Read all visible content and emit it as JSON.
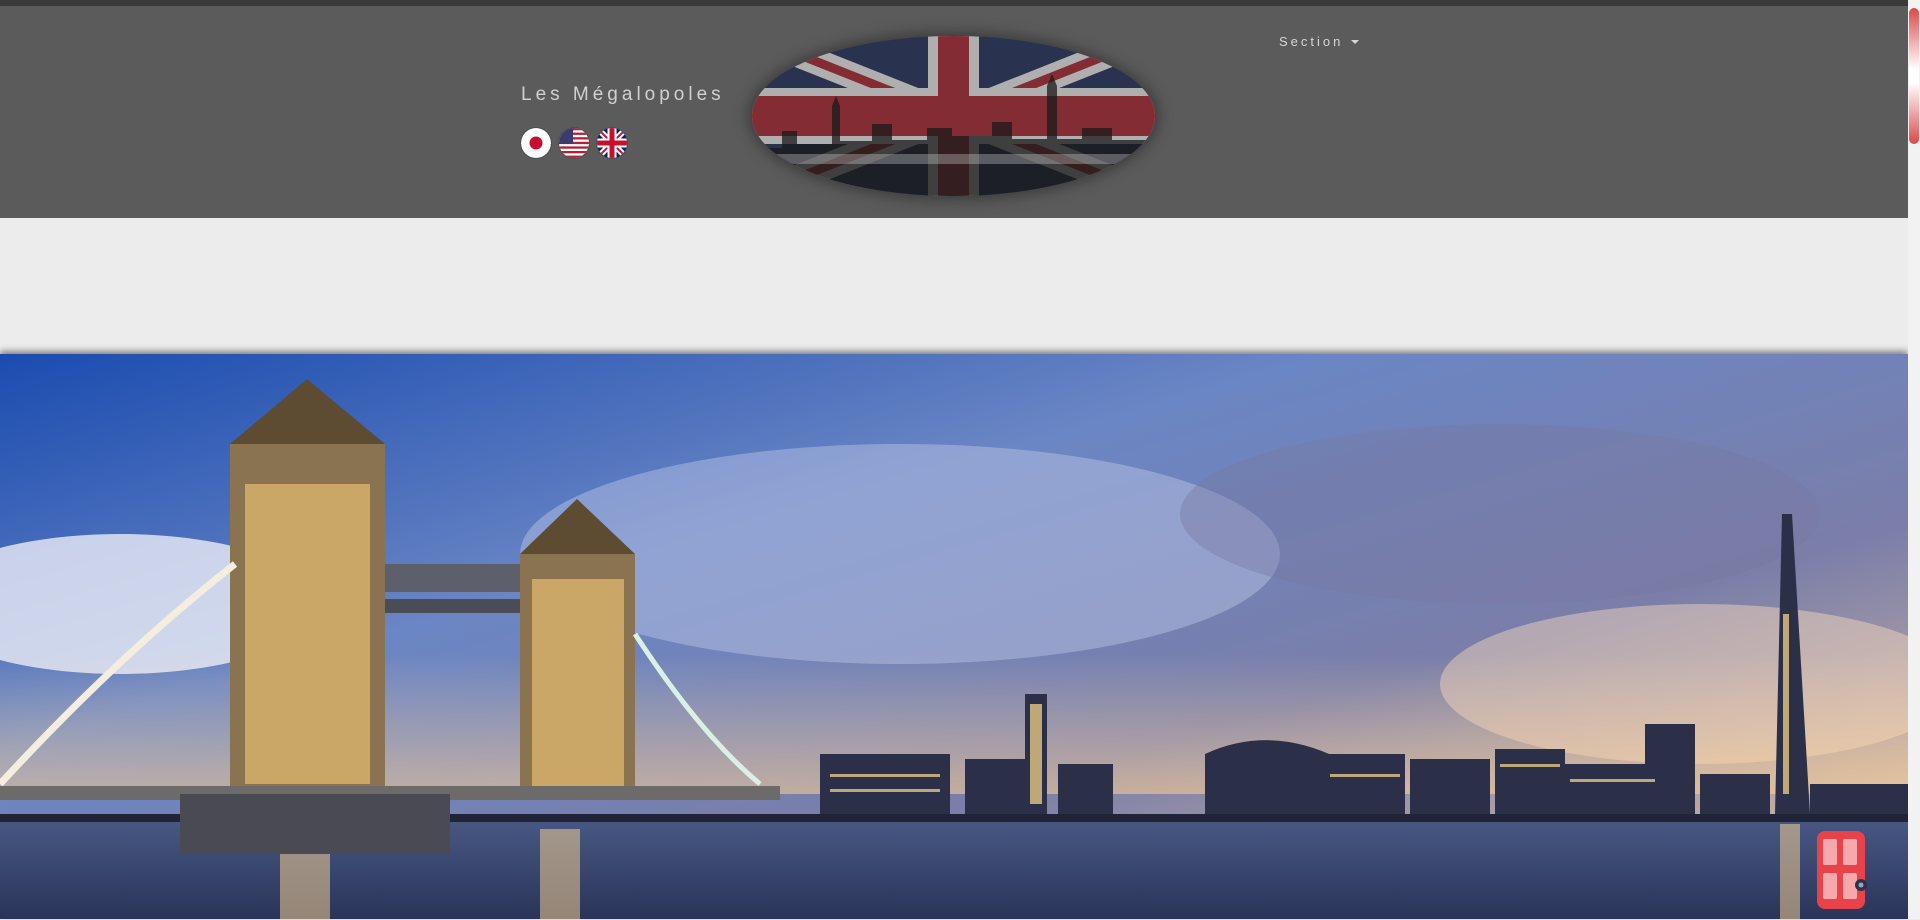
{
  "site": {
    "brand": "Les Mégalopoles"
  },
  "nav": {
    "section_label": "Section"
  },
  "flags": [
    {
      "name": "japan-flag-icon"
    },
    {
      "name": "usa-flag-icon"
    },
    {
      "name": "uk-flag-icon"
    }
  ],
  "colors": {
    "header_bg": "#5b5b5b",
    "page_bg": "#ececec",
    "accent_red": "#d94a4a"
  },
  "icons": {
    "logo": "union-jack-skyline-logo",
    "hero": "london-skyline-hero-image",
    "bus": "red-bus-icon"
  }
}
